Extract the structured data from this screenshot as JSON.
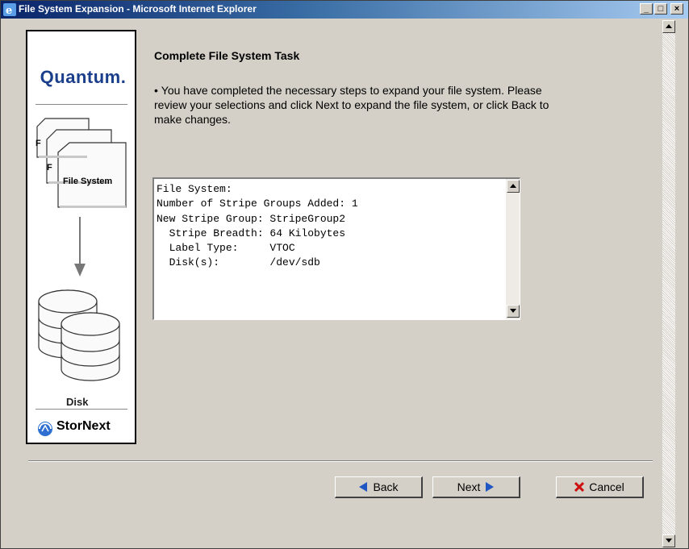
{
  "window": {
    "title": "File System Expansion - Microsoft Internet Explorer",
    "controls": {
      "minimize": "_",
      "maximize": "□",
      "close": "×"
    }
  },
  "sidebar": {
    "brand": "Quantum.",
    "file_system_label": "File System",
    "disk_label": "Disk",
    "product": "StorNext"
  },
  "main": {
    "heading": "Complete File System Task",
    "description": "You have completed the necessary steps to expand your file system. Please review your selections and click Next to expand the file system, or click Back to make changes.",
    "summary_lines": [
      "File System:",
      "Number of Stripe Groups Added: 1",
      "New Stripe Group: StripeGroup2",
      "  Stripe Breadth: 64 Kilobytes",
      "  Label Type:     VTOC",
      "  Disk(s):        /dev/sdb"
    ]
  },
  "buttons": {
    "back": "Back",
    "next": "Next",
    "cancel": "Cancel"
  },
  "icons": {
    "back": "left-arrow-icon",
    "next": "right-arrow-icon",
    "cancel": "red-x-icon"
  },
  "colors": {
    "brand_blue": "#1c3f8c",
    "arrow_blue": "#1f56c4",
    "cancel_red": "#cc1010",
    "titlebar_start": "#0a246a",
    "titlebar_end": "#a6caf0"
  }
}
